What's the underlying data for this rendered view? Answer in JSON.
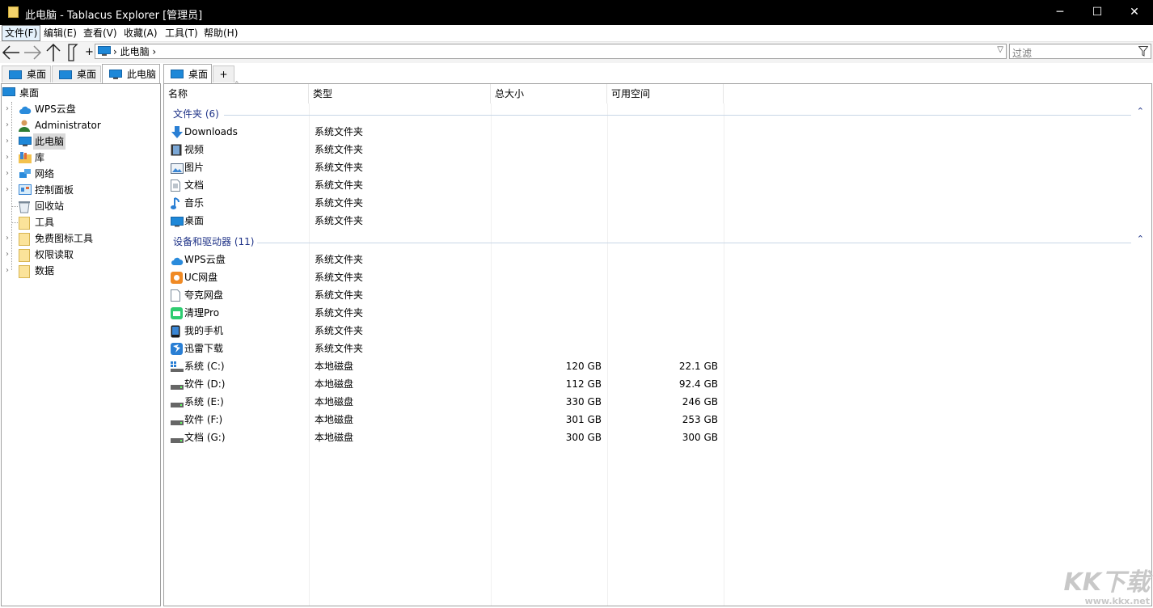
{
  "window": {
    "title": "此电脑 - Tablacus Explorer [管理员]",
    "minimize": "─",
    "maximize": "☐",
    "close": "✕"
  },
  "menu": [
    {
      "label": "文件(F)"
    },
    {
      "label": "编辑(E)"
    },
    {
      "label": "查看(V)"
    },
    {
      "label": "收藏(A)"
    },
    {
      "label": "工具(T)"
    },
    {
      "label": "帮助(H)"
    }
  ],
  "toolbar": {
    "plus": "+"
  },
  "address": {
    "path": "› 此电脑 ›"
  },
  "filter": {
    "placeholder": "过滤"
  },
  "left_tabs": [
    {
      "label": "桌面"
    },
    {
      "label": "桌面"
    },
    {
      "label": "此电脑"
    }
  ],
  "right_tabs": [
    {
      "label": "桌面"
    }
  ],
  "new_tab": "+",
  "tree": {
    "root": "桌面",
    "items": [
      {
        "label": "WPS云盘",
        "icon": "cloud-icon",
        "expandable": true
      },
      {
        "label": "Administrator",
        "icon": "user-icon",
        "expandable": true
      },
      {
        "label": "此电脑",
        "icon": "computer-icon",
        "expandable": true,
        "selected": true
      },
      {
        "label": "库",
        "icon": "library-icon",
        "expandable": true
      },
      {
        "label": "网络",
        "icon": "network-icon",
        "expandable": true
      },
      {
        "label": "控制面板",
        "icon": "control-panel-icon",
        "expandable": true
      },
      {
        "label": "回收站",
        "icon": "recycle-bin-icon",
        "expandable": false
      },
      {
        "label": "工具",
        "icon": "folder-icon",
        "expandable": false
      },
      {
        "label": "免费图标工具",
        "icon": "folder-icon",
        "expandable": true
      },
      {
        "label": "权限读取",
        "icon": "folder-icon",
        "expandable": true
      },
      {
        "label": "数据",
        "icon": "folder-icon",
        "expandable": true
      }
    ]
  },
  "columns": [
    {
      "label": "名称"
    },
    {
      "label": "类型"
    },
    {
      "label": "总大小"
    },
    {
      "label": "可用空间"
    }
  ],
  "groups": [
    {
      "label": "文件夹 (6)",
      "rows": [
        {
          "name": "Downloads",
          "type": "系统文件夹",
          "size": "",
          "free": "",
          "icon": "download-icon"
        },
        {
          "name": "视频",
          "type": "系统文件夹",
          "size": "",
          "free": "",
          "icon": "video-icon"
        },
        {
          "name": "图片",
          "type": "系统文件夹",
          "size": "",
          "free": "",
          "icon": "picture-icon"
        },
        {
          "name": "文档",
          "type": "系统文件夹",
          "size": "",
          "free": "",
          "icon": "document-icon"
        },
        {
          "name": "音乐",
          "type": "系统文件夹",
          "size": "",
          "free": "",
          "icon": "music-icon"
        },
        {
          "name": "桌面",
          "type": "系统文件夹",
          "size": "",
          "free": "",
          "icon": "desktop-icon"
        }
      ]
    },
    {
      "label": "设备和驱动器 (11)",
      "rows": [
        {
          "name": "WPS云盘",
          "type": "系统文件夹",
          "size": "",
          "free": "",
          "icon": "cloud-icon"
        },
        {
          "name": "UC网盘",
          "type": "系统文件夹",
          "size": "",
          "free": "",
          "icon": "uc-drive-icon"
        },
        {
          "name": "夸克网盘",
          "type": "系统文件夹",
          "size": "",
          "free": "",
          "icon": "blank-file-icon"
        },
        {
          "name": "清理Pro",
          "type": "系统文件夹",
          "size": "",
          "free": "",
          "icon": "cleaner-icon"
        },
        {
          "name": "我的手机",
          "type": "系统文件夹",
          "size": "",
          "free": "",
          "icon": "phone-icon"
        },
        {
          "name": "迅雷下载",
          "type": "系统文件夹",
          "size": "",
          "free": "",
          "icon": "thunder-icon"
        },
        {
          "name": "系统 (C:)",
          "type": "本地磁盘",
          "size": "120 GB",
          "free": "22.1 GB",
          "icon": "system-drive-icon"
        },
        {
          "name": "软件 (D:)",
          "type": "本地磁盘",
          "size": "112 GB",
          "free": "92.4 GB",
          "icon": "drive-icon"
        },
        {
          "name": "系统 (E:)",
          "type": "本地磁盘",
          "size": "330 GB",
          "free": "246 GB",
          "icon": "drive-icon"
        },
        {
          "name": "软件 (F:)",
          "type": "本地磁盘",
          "size": "301 GB",
          "free": "253 GB",
          "icon": "drive-icon"
        },
        {
          "name": "文档 (G:)",
          "type": "本地磁盘",
          "size": "300 GB",
          "free": "300 GB",
          "icon": "drive-icon"
        }
      ]
    }
  ],
  "watermark": {
    "brand": "KK下载",
    "url": "www.kkx.net"
  }
}
